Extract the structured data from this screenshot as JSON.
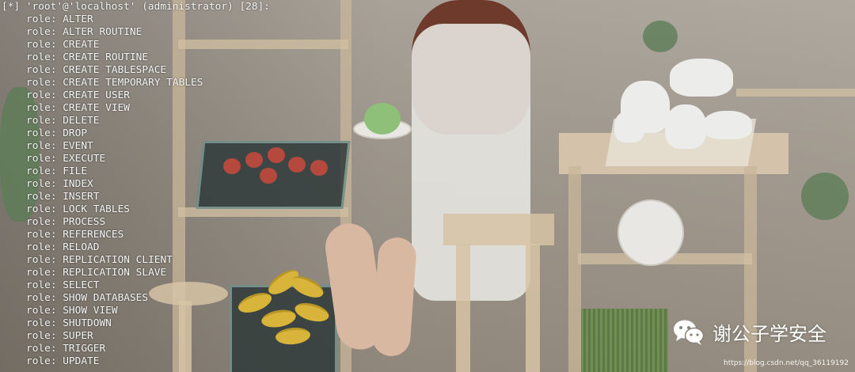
{
  "terminal": {
    "header": "[*] 'root'@'localhost' (administrator) [28]:",
    "roles": [
      "role: ALTER",
      "role: ALTER ROUTINE",
      "role: CREATE",
      "role: CREATE ROUTINE",
      "role: CREATE TABLESPACE",
      "role: CREATE TEMPORARY TABLES",
      "role: CREATE USER",
      "role: CREATE VIEW",
      "role: DELETE",
      "role: DROP",
      "role: EVENT",
      "role: EXECUTE",
      "role: FILE",
      "role: INDEX",
      "role: INSERT",
      "role: LOCK TABLES",
      "role: PROCESS",
      "role: REFERENCES",
      "role: RELOAD",
      "role: REPLICATION CLIENT",
      "role: REPLICATION SLAVE",
      "role: SELECT",
      "role: SHOW DATABASES",
      "role: SHOW VIEW",
      "role: SHUTDOWN",
      "role: SUPER",
      "role: TRIGGER",
      "role: UPDATE"
    ]
  },
  "watermark": {
    "wechat_label": "谢公子学安全",
    "icon": "wechat-icon",
    "url": "https://blog.csdn.net/qq_36119192"
  },
  "colors": {
    "terminal_text": "#f4f4f4",
    "watermark_text": "#ffffff"
  }
}
